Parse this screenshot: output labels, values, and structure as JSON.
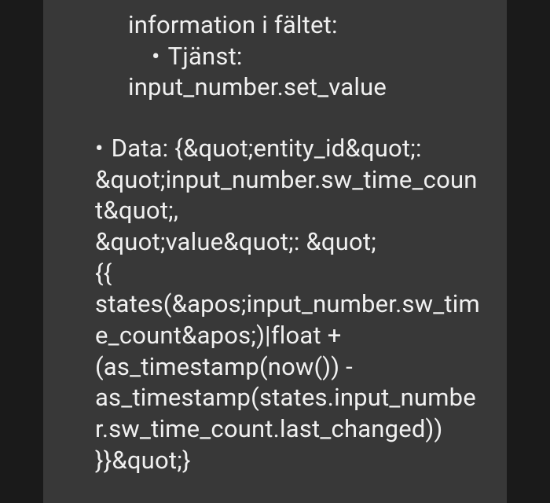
{
  "section1": {
    "line1": "information i fältet:",
    "bullet_label": "Tjänst:",
    "service_value": "input_number.set_value"
  },
  "section2": {
    "bullet_label": "Data:",
    "data_line1": "Data: {&quot;entity_id&quot;:",
    "data_line2": "&quot;input_number.sw_time_count&quot;,",
    "data_line3": "&quot;value&quot;: &quot;",
    "data_line4": "{{ states(&apos;input_number.sw_time_count&apos;)|float + (as_timestamp(now()) - as_timestamp(states.input_number.sw_time_count.last_changed)) }}&quot;}"
  }
}
